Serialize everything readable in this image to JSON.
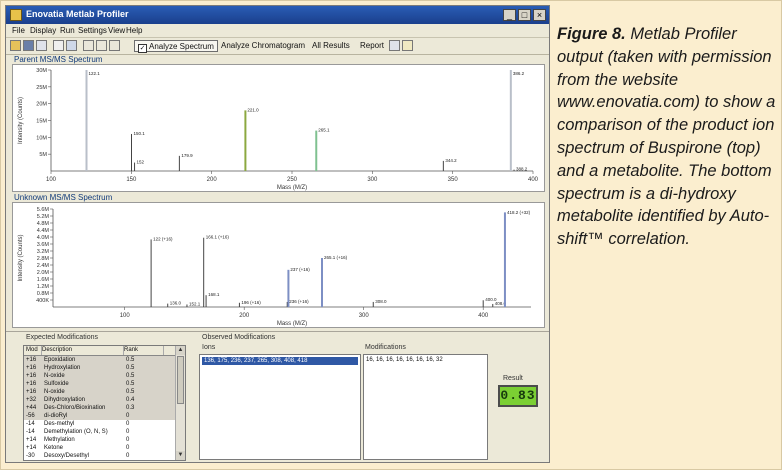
{
  "app": {
    "window_title": "Enovatia Metlab Profiler",
    "menu": [
      "File",
      "Display",
      "Run",
      "Settings",
      "View",
      "Help"
    ],
    "toolbar_buttons": [
      "Analyze Spectrum",
      "Analyze Chromatogram",
      "All Results",
      "Report"
    ],
    "toolbar_icons": [
      "folder-icon",
      "save-icon",
      "copy-icon",
      "print-icon",
      "zoom-icon",
      "redo-icon",
      "undo-icon",
      "arrow-icon",
      "help-icon"
    ],
    "active_button": "Analyze Spectrum"
  },
  "panels": {
    "top_title": "Parent MS/MS Spectrum",
    "bottom_title": "Unknown MS/MS Spectrum"
  },
  "chart_data": [
    {
      "type": "bar",
      "title": "Parent MS/MS Spectrum",
      "xlabel": "Mass (M/Z)",
      "ylabel": "Intensity (Counts)",
      "xlim": [
        100,
        400
      ],
      "ylim": [
        0,
        30000000
      ],
      "x_ticks": [
        100,
        150,
        200,
        250,
        300,
        350,
        400
      ],
      "y_ticks": [
        "5M",
        "10M",
        "15M",
        "20M",
        "25M",
        "30M"
      ],
      "peaks": [
        {
          "x": 122.1,
          "y": 30000000,
          "label": "122.1",
          "color": "#b9bfc9"
        },
        {
          "x": 150.1,
          "y": 11000000,
          "label": "150.1",
          "color": "#444444"
        },
        {
          "x": 152.0,
          "y": 2500000,
          "label": "152",
          "color": "#444444"
        },
        {
          "x": 179.9,
          "y": 4500000,
          "label": "179.9",
          "color": "#444444"
        },
        {
          "x": 221.0,
          "y": 18000000,
          "label": "221.0",
          "color": "#8ca840"
        },
        {
          "x": 265.1,
          "y": 12000000,
          "label": "265.1",
          "color": "#7fc190"
        },
        {
          "x": 344.2,
          "y": 3000000,
          "label": "344.2",
          "color": "#444444"
        },
        {
          "x": 386.2,
          "y": 30000000,
          "label": "386.2",
          "color": "#b9bfc9"
        },
        {
          "x": 388.2,
          "y": 400000,
          "label": "388.2",
          "color": "#444444"
        }
      ]
    },
    {
      "type": "bar",
      "title": "Unknown MS/MS Spectrum",
      "xlabel": "Mass (M/Z)",
      "ylabel": "Intensity (Counts)",
      "xlim": [
        40,
        440
      ],
      "ylim": [
        0,
        5800000
      ],
      "x_ticks": [
        100,
        200,
        300,
        400
      ],
      "y_ticks": [
        "400K",
        "0.8M",
        "1.2M",
        "1.6M",
        "2.0M",
        "2.4M",
        "2.8M",
        "3.2M",
        "3.6M",
        "4.0M",
        "4.4M",
        "4.8M",
        "5.2M",
        "5.6M"
      ],
      "peaks": [
        {
          "x": 122.1,
          "y": 4000000,
          "label": "122 (+16)",
          "color": "#444444"
        },
        {
          "x": 136.0,
          "y": 200000,
          "label": "136.0",
          "color": "#444444"
        },
        {
          "x": 152.1,
          "y": 150000,
          "label": "152.1",
          "color": "#444444"
        },
        {
          "x": 166.1,
          "y": 4100000,
          "label": "166.1 (+16)",
          "color": "#444444"
        },
        {
          "x": 168.1,
          "y": 700000,
          "label": "168.1",
          "color": "#444444"
        },
        {
          "x": 196.0,
          "y": 250000,
          "label": "196 (+16)",
          "color": "#444444"
        },
        {
          "x": 236.0,
          "y": 300000,
          "label": "236 (+16)",
          "color": "#444444"
        },
        {
          "x": 237.0,
          "y": 2200000,
          "label": "237 (+16)",
          "color": "#7d8fc4"
        },
        {
          "x": 265.1,
          "y": 2900000,
          "label": "265.1 (+16)",
          "color": "#7d8fc4"
        },
        {
          "x": 308.0,
          "y": 300000,
          "label": "308.0",
          "color": "#444444"
        },
        {
          "x": 400.0,
          "y": 400000,
          "label": "400.0",
          "color": "#444444"
        },
        {
          "x": 408.0,
          "y": 180000,
          "label": "408.0",
          "color": "#444444"
        },
        {
          "x": 418.2,
          "y": 5600000,
          "label": "418.2 (+32)",
          "color": "#7d8fc4"
        }
      ]
    }
  ],
  "modifications": {
    "title": "Expected Modifications",
    "columns": [
      "Mod",
      "Description",
      "Rank"
    ],
    "rows": [
      {
        "mod": "+16",
        "desc": "Epoxidation",
        "rank": "0.5",
        "hl": true
      },
      {
        "mod": "+16",
        "desc": "Hydroxylation",
        "rank": "0.5",
        "hl": true
      },
      {
        "mod": "+16",
        "desc": "N-oxide",
        "rank": "0.5",
        "hl": true
      },
      {
        "mod": "+16",
        "desc": "Sulfoxide",
        "rank": "0.5",
        "hl": true
      },
      {
        "mod": "+16",
        "desc": "N-oxide",
        "rank": "0.5",
        "hl": true
      },
      {
        "mod": "+32",
        "desc": "Dihydroxylation",
        "rank": "0.4",
        "hl": true
      },
      {
        "mod": "+44",
        "desc": "Des-Chloro/Bioxination",
        "rank": "0.3",
        "hl": true
      },
      {
        "mod": "-56",
        "desc": "di-dioRyl",
        "rank": "0",
        "hl": true
      },
      {
        "mod": "-14",
        "desc": "Des-methyl",
        "rank": "0",
        "hl": false
      },
      {
        "mod": "-14",
        "desc": "Demethylation (O, N, S)",
        "rank": "0",
        "hl": false
      },
      {
        "mod": "+14",
        "desc": "Methylation",
        "rank": "0",
        "hl": false
      },
      {
        "mod": "+14",
        "desc": "Ketone",
        "rank": "0",
        "hl": false
      },
      {
        "mod": "-30",
        "desc": "Desoxy/Desethyl",
        "rank": "0",
        "hl": false
      }
    ]
  },
  "observed": {
    "title": "Observed Modifications",
    "ions_label": "Ions",
    "ions_value": "136, 175, 236, 237, 265, 308, 408, 418",
    "mods_label": "Modifications",
    "mods_value": "16, 16, 16, 16, 16, 16, 16, 32"
  },
  "result": {
    "label": "Result",
    "value": "0.83"
  },
  "caption": {
    "figure": "Figure 8.",
    "text": "Metlab Profiler output (taken with permission from the website www.enovatia.com) to show a comparison of the product ion spectrum of Buspirone (top) and a metabolite. The bottom spectrum is a di-hydroxy metabolite identified by Auto-shift™ correlation."
  }
}
